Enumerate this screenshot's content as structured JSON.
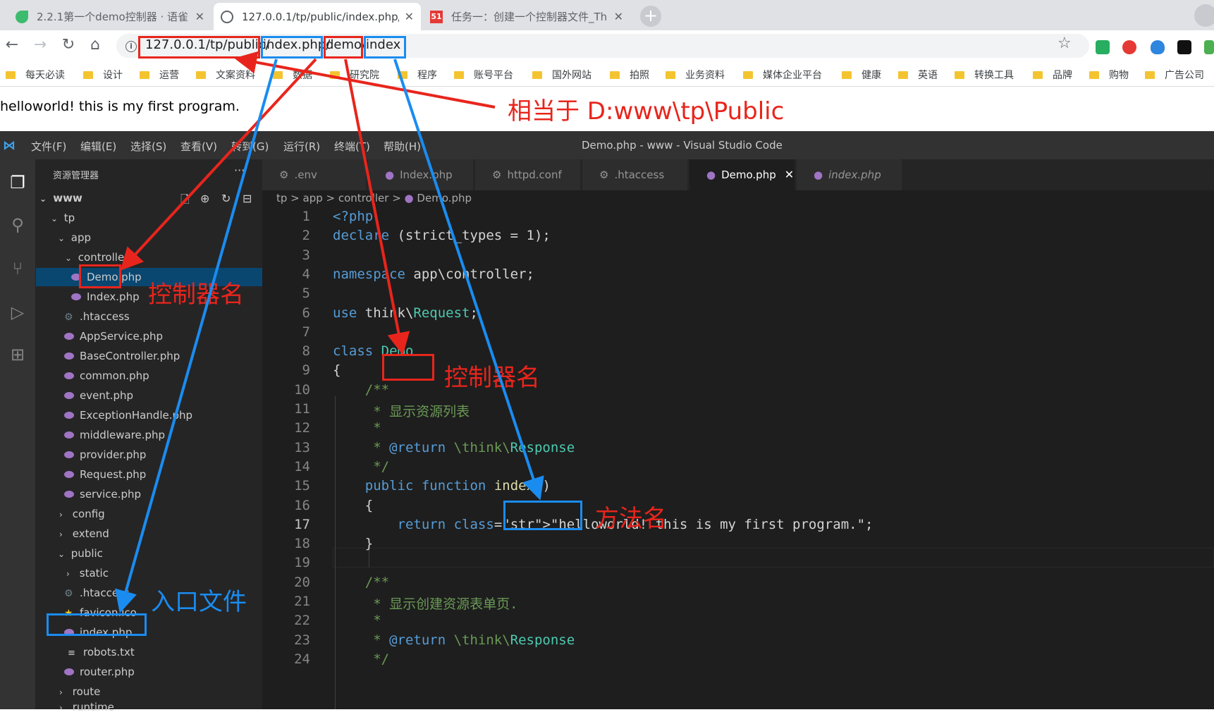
{
  "browser": {
    "tabs": [
      {
        "title": "2.2.1第一个demo控制器 · 语雀",
        "active": false
      },
      {
        "title": "127.0.0.1/tp/public/index.php/",
        "active": true
      },
      {
        "title": "任务一：创建一个控制器文件_Th",
        "active": false
      }
    ],
    "tab_badge": "51",
    "url_segments": [
      "127.0.0.1/tp/public/",
      "index.php/",
      "demo/",
      "index"
    ],
    "bookmarks": [
      "每天必读",
      "设计",
      "运营",
      "文案资料",
      "数据",
      "研究院",
      "程序",
      "账号平台",
      "国外网站",
      "拍照",
      "业务资料",
      "媒体企业平台",
      "健康",
      "英语",
      "转换工具",
      "品牌",
      "购物",
      "广告公司"
    ]
  },
  "page": {
    "text": "helloworld!  this is my first program."
  },
  "annotations": {
    "public_hint": "相当于 D:www\\tp\\Public",
    "controller_name_tree": "控制器名",
    "controller_name_code": "控制器名",
    "method_name": "方法名",
    "entry_file": "入口文件",
    "red_color": "#e8251c",
    "blue_color": "#1a8cf0"
  },
  "vscode": {
    "window_title": "Demo.php - www - Visual Studio Code",
    "menu": [
      "文件(F)",
      "编辑(E)",
      "选择(S)",
      "查看(V)",
      "转到(G)",
      "运行(R)",
      "终端(T)",
      "帮助(H)"
    ],
    "explorer_title": "资源管理器",
    "explorer_dots": "···",
    "tree": [
      {
        "label": "www",
        "type": "root"
      },
      {
        "label": "tp",
        "type": "folder-open"
      },
      {
        "label": "app",
        "type": "folder-open"
      },
      {
        "label": "controller",
        "type": "folder-open"
      },
      {
        "label": "Demo.php",
        "type": "php",
        "selected": true
      },
      {
        "label": "Index.php",
        "type": "php"
      },
      {
        "label": ".htaccess",
        "type": "gear"
      },
      {
        "label": "AppService.php",
        "type": "php"
      },
      {
        "label": "BaseController.php",
        "type": "php"
      },
      {
        "label": "common.php",
        "type": "php"
      },
      {
        "label": "event.php",
        "type": "php"
      },
      {
        "label": "ExceptionHandle.php",
        "type": "php"
      },
      {
        "label": "middleware.php",
        "type": "php"
      },
      {
        "label": "provider.php",
        "type": "php"
      },
      {
        "label": "Request.php",
        "type": "php"
      },
      {
        "label": "service.php",
        "type": "php"
      },
      {
        "label": "config",
        "type": "folder"
      },
      {
        "label": "extend",
        "type": "folder"
      },
      {
        "label": "public",
        "type": "folder-open"
      },
      {
        "label": "static",
        "type": "folder"
      },
      {
        "label": ".htaccess",
        "type": "gear"
      },
      {
        "label": "favicon.ico",
        "type": "star"
      },
      {
        "label": "index.php",
        "type": "php"
      },
      {
        "label": "robots.txt",
        "type": "list"
      },
      {
        "label": "router.php",
        "type": "php"
      },
      {
        "label": "route",
        "type": "folder"
      },
      {
        "label": "runtime",
        "type": "folder"
      }
    ],
    "editor_tabs": [
      ".env",
      "Index.php",
      "httpd.conf",
      ".htaccess",
      "Demo.php",
      "index.php"
    ],
    "active_tab": "Demo.php",
    "breadcrumb": [
      "tp",
      "app",
      "controller",
      "Demo.php"
    ],
    "current_line": 17,
    "code_lines": [
      "<?php",
      "declare (strict_types = 1);",
      "",
      "namespace app\\controller;",
      "",
      "use think\\Request;",
      "",
      "class Demo",
      "{",
      "    /**",
      "     * 显示资源列表",
      "     *",
      "     * @return \\think\\Response",
      "     */",
      "    public function index()",
      "    {",
      "        return \"helloworld! this is my first program.\";",
      "    }",
      "",
      "    /**",
      "     * 显示创建资源表单页.",
      "     *",
      "     * @return \\think\\Response",
      "     */"
    ]
  }
}
